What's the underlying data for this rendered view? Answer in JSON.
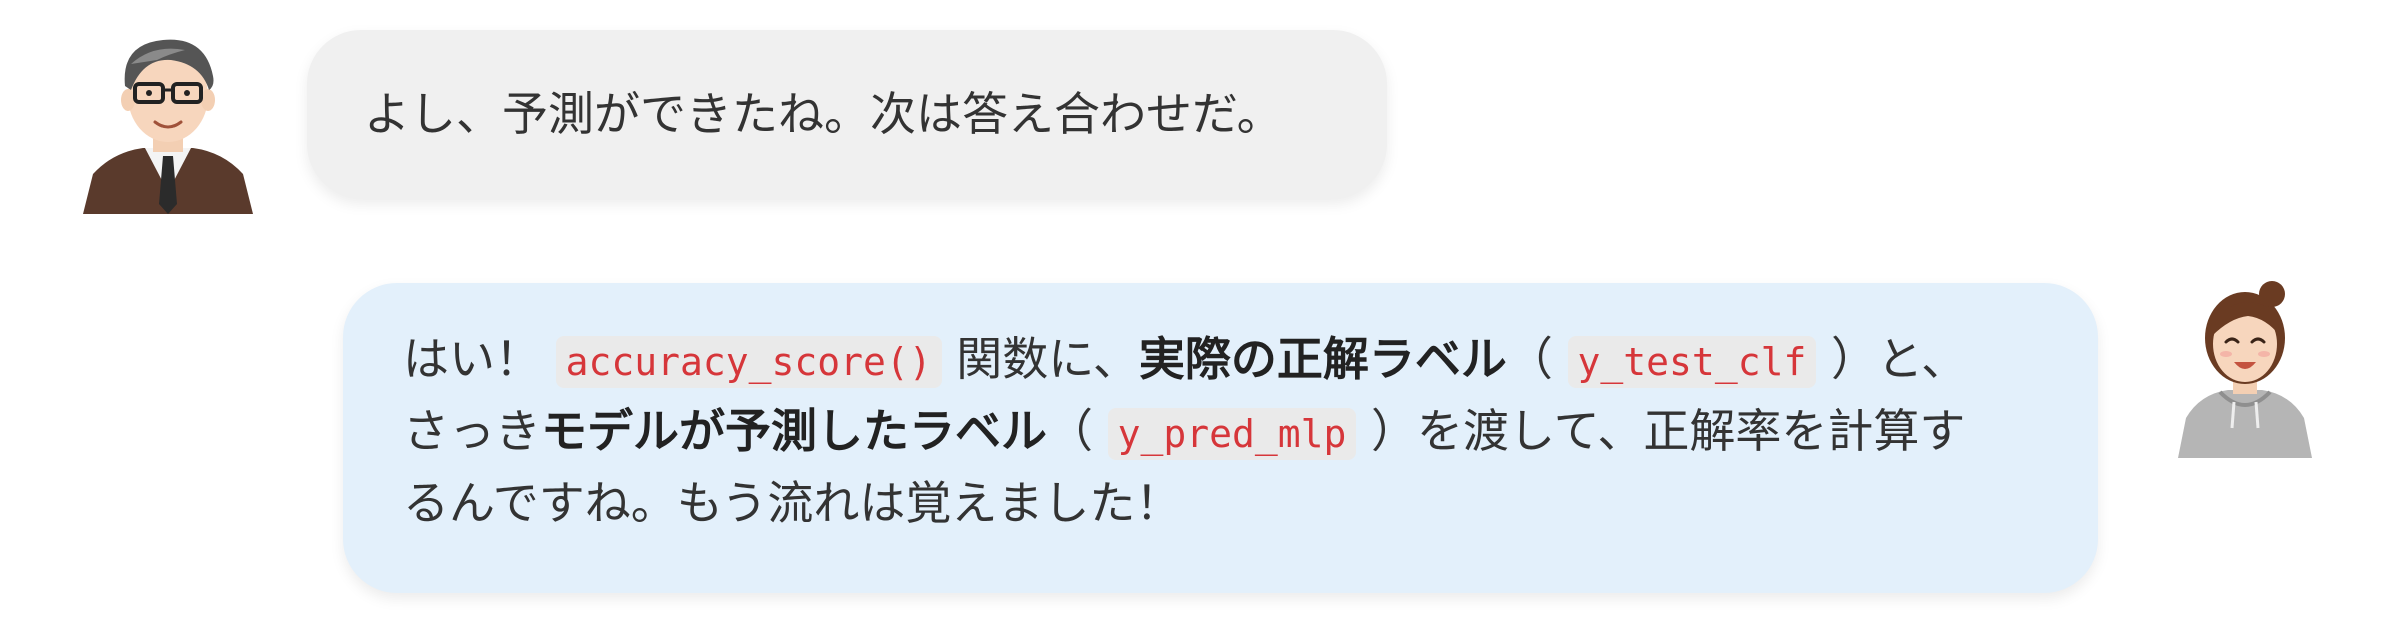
{
  "teacher": {
    "message": "よし、予測ができたね。次は答え合わせだ。"
  },
  "student": {
    "lines": [
      {
        "t1": "はい！ ",
        "code1": "accuracy_score()",
        "t2": " 関数に、",
        "bold1": "実際の正解ラベル",
        "t3": "（ ",
        "code2": "y_test_clf",
        "t4": " ）と、"
      },
      {
        "t1": "さっき",
        "bold1": "モデルが予測したラベル",
        "t2": "（ ",
        "code1": "y_pred_mlp",
        "t3": " ）を渡して、正解率を計算す"
      },
      {
        "t1": "るんですね。もう流れは覚えました！"
      }
    ]
  },
  "colors": {
    "teacher_bubble": "#f0f0f0",
    "student_bubble": "#e3f0fb",
    "code_text": "#d6363a",
    "code_bg": "#eaeaea"
  },
  "icons": {
    "teacher": "teacher-avatar-icon",
    "student": "student-avatar-icon"
  }
}
